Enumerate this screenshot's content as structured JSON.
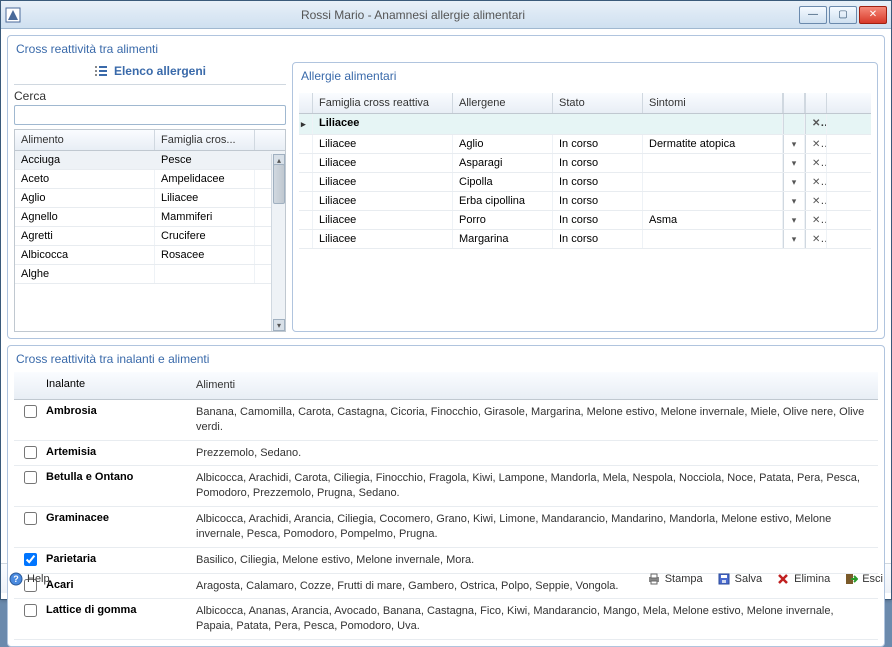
{
  "window": {
    "title": "Rossi Mario - Anamnesi allergie alimentari"
  },
  "groups": {
    "cross_foods": "Cross reattività tra alimenti",
    "elenco": "Elenco allergeni",
    "cerca_label": "Cerca",
    "search_value": "",
    "allergie": "Allergie alimentari",
    "cross_inhal": "Cross reattività tra inalanti e alimenti"
  },
  "left_grid": {
    "headers": {
      "c1": "Alimento",
      "c2": "Famiglia cros..."
    },
    "rows": [
      {
        "alimento": "Acciuga",
        "famiglia": "Pesce"
      },
      {
        "alimento": "Aceto",
        "famiglia": "Ampelidacee"
      },
      {
        "alimento": "Aglio",
        "famiglia": "Liliacee"
      },
      {
        "alimento": "Agnello",
        "famiglia": "Mammiferi"
      },
      {
        "alimento": "Agretti",
        "famiglia": "Crucifere"
      },
      {
        "alimento": "Albicocca",
        "famiglia": "Rosacee"
      },
      {
        "alimento": "Alghe",
        "famiglia": ""
      }
    ]
  },
  "allerg_grid": {
    "headers": {
      "c1": "Famiglia cross reattiva",
      "c2": "Allergene",
      "c3": "Stato",
      "c4": "Sintomi"
    },
    "group_row": {
      "label": "Liliacee"
    },
    "rows": [
      {
        "famiglia": "Liliacee",
        "allergene": "Aglio",
        "stato": "In corso",
        "sintomi": "Dermatite atopica"
      },
      {
        "famiglia": "Liliacee",
        "allergene": "Asparagi",
        "stato": "In corso",
        "sintomi": ""
      },
      {
        "famiglia": "Liliacee",
        "allergene": "Cipolla",
        "stato": "In corso",
        "sintomi": ""
      },
      {
        "famiglia": "Liliacee",
        "allergene": "Erba cipollina",
        "stato": "In corso",
        "sintomi": ""
      },
      {
        "famiglia": "Liliacee",
        "allergene": "Porro",
        "stato": "In corso",
        "sintomi": "Asma"
      },
      {
        "famiglia": "Liliacee",
        "allergene": "Margarina",
        "stato": "In corso",
        "sintomi": ""
      }
    ]
  },
  "inhal_grid": {
    "headers": {
      "c1": "Inalante",
      "c2": "Alimenti"
    },
    "rows": [
      {
        "checked": false,
        "inalante": "Ambrosia",
        "alimenti": "Banana, Camomilla, Carota, Castagna, Cicoria, Finocchio, Girasole, Margarina, Melone estivo, Melone invernale, Miele, Olive nere, Olive verdi."
      },
      {
        "checked": false,
        "inalante": "Artemisia",
        "alimenti": "Prezzemolo, Sedano."
      },
      {
        "checked": false,
        "inalante": "Betulla e Ontano",
        "alimenti": "Albicocca, Arachidi, Carota, Ciliegia, Finocchio, Fragola, Kiwi, Lampone, Mandorla, Mela, Nespola, Nocciola, Noce, Patata, Pera, Pesca, Pomodoro, Prezzemolo, Prugna, Sedano."
      },
      {
        "checked": false,
        "inalante": "Graminacee",
        "alimenti": "Albicocca, Arachidi, Arancia, Ciliegia, Cocomero, Grano, Kiwi, Limone, Mandarancio, Mandarino, Mandorla, Melone estivo, Melone invernale, Pesca, Pomodoro, Pompelmo, Prugna."
      },
      {
        "checked": true,
        "inalante": "Parietaria",
        "alimenti": "Basilico, Ciliegia, Melone estivo, Melone invernale, Mora."
      },
      {
        "checked": false,
        "inalante": "Acari",
        "alimenti": "Aragosta, Calamaro, Cozze, Frutti di mare, Gambero, Ostrica, Polpo, Seppie, Vongola."
      },
      {
        "checked": false,
        "inalante": "Lattice di gomma",
        "alimenti": "Albicocca, Ananas, Arancia, Avocado, Banana, Castagna, Fico, Kiwi, Mandarancio, Mango, Mela, Melone estivo, Melone invernale, Papaia, Patata, Pera, Pesca, Pomodoro, Uva."
      }
    ]
  },
  "footer": {
    "help": "Help",
    "stampa": "Stampa",
    "salva": "Salva",
    "elimina": "Elimina",
    "esci": "Esci"
  }
}
